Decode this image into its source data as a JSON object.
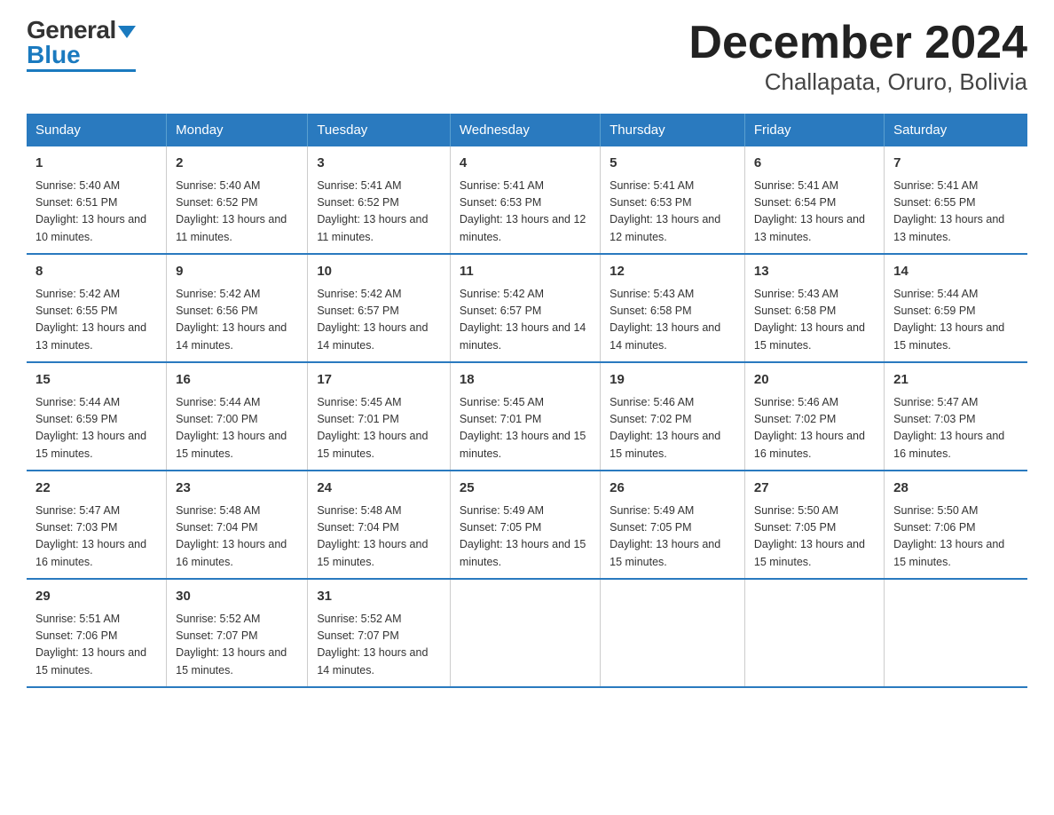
{
  "logo": {
    "general": "General",
    "blue": "Blue",
    "arrow": "▼"
  },
  "title": "December 2024",
  "subtitle": "Challapata, Oruro, Bolivia",
  "weekdays": [
    "Sunday",
    "Monday",
    "Tuesday",
    "Wednesday",
    "Thursday",
    "Friday",
    "Saturday"
  ],
  "weeks": [
    [
      {
        "day": "1",
        "sunrise": "5:40 AM",
        "sunset": "6:51 PM",
        "daylight": "13 hours and 10 minutes."
      },
      {
        "day": "2",
        "sunrise": "5:40 AM",
        "sunset": "6:52 PM",
        "daylight": "13 hours and 11 minutes."
      },
      {
        "day": "3",
        "sunrise": "5:41 AM",
        "sunset": "6:52 PM",
        "daylight": "13 hours and 11 minutes."
      },
      {
        "day": "4",
        "sunrise": "5:41 AM",
        "sunset": "6:53 PM",
        "daylight": "13 hours and 12 minutes."
      },
      {
        "day": "5",
        "sunrise": "5:41 AM",
        "sunset": "6:53 PM",
        "daylight": "13 hours and 12 minutes."
      },
      {
        "day": "6",
        "sunrise": "5:41 AM",
        "sunset": "6:54 PM",
        "daylight": "13 hours and 13 minutes."
      },
      {
        "day": "7",
        "sunrise": "5:41 AM",
        "sunset": "6:55 PM",
        "daylight": "13 hours and 13 minutes."
      }
    ],
    [
      {
        "day": "8",
        "sunrise": "5:42 AM",
        "sunset": "6:55 PM",
        "daylight": "13 hours and 13 minutes."
      },
      {
        "day": "9",
        "sunrise": "5:42 AM",
        "sunset": "6:56 PM",
        "daylight": "13 hours and 14 minutes."
      },
      {
        "day": "10",
        "sunrise": "5:42 AM",
        "sunset": "6:57 PM",
        "daylight": "13 hours and 14 minutes."
      },
      {
        "day": "11",
        "sunrise": "5:42 AM",
        "sunset": "6:57 PM",
        "daylight": "13 hours and 14 minutes."
      },
      {
        "day": "12",
        "sunrise": "5:43 AM",
        "sunset": "6:58 PM",
        "daylight": "13 hours and 14 minutes."
      },
      {
        "day": "13",
        "sunrise": "5:43 AM",
        "sunset": "6:58 PM",
        "daylight": "13 hours and 15 minutes."
      },
      {
        "day": "14",
        "sunrise": "5:44 AM",
        "sunset": "6:59 PM",
        "daylight": "13 hours and 15 minutes."
      }
    ],
    [
      {
        "day": "15",
        "sunrise": "5:44 AM",
        "sunset": "6:59 PM",
        "daylight": "13 hours and 15 minutes."
      },
      {
        "day": "16",
        "sunrise": "5:44 AM",
        "sunset": "7:00 PM",
        "daylight": "13 hours and 15 minutes."
      },
      {
        "day": "17",
        "sunrise": "5:45 AM",
        "sunset": "7:01 PM",
        "daylight": "13 hours and 15 minutes."
      },
      {
        "day": "18",
        "sunrise": "5:45 AM",
        "sunset": "7:01 PM",
        "daylight": "13 hours and 15 minutes."
      },
      {
        "day": "19",
        "sunrise": "5:46 AM",
        "sunset": "7:02 PM",
        "daylight": "13 hours and 15 minutes."
      },
      {
        "day": "20",
        "sunrise": "5:46 AM",
        "sunset": "7:02 PM",
        "daylight": "13 hours and 16 minutes."
      },
      {
        "day": "21",
        "sunrise": "5:47 AM",
        "sunset": "7:03 PM",
        "daylight": "13 hours and 16 minutes."
      }
    ],
    [
      {
        "day": "22",
        "sunrise": "5:47 AM",
        "sunset": "7:03 PM",
        "daylight": "13 hours and 16 minutes."
      },
      {
        "day": "23",
        "sunrise": "5:48 AM",
        "sunset": "7:04 PM",
        "daylight": "13 hours and 16 minutes."
      },
      {
        "day": "24",
        "sunrise": "5:48 AM",
        "sunset": "7:04 PM",
        "daylight": "13 hours and 15 minutes."
      },
      {
        "day": "25",
        "sunrise": "5:49 AM",
        "sunset": "7:05 PM",
        "daylight": "13 hours and 15 minutes."
      },
      {
        "day": "26",
        "sunrise": "5:49 AM",
        "sunset": "7:05 PM",
        "daylight": "13 hours and 15 minutes."
      },
      {
        "day": "27",
        "sunrise": "5:50 AM",
        "sunset": "7:05 PM",
        "daylight": "13 hours and 15 minutes."
      },
      {
        "day": "28",
        "sunrise": "5:50 AM",
        "sunset": "7:06 PM",
        "daylight": "13 hours and 15 minutes."
      }
    ],
    [
      {
        "day": "29",
        "sunrise": "5:51 AM",
        "sunset": "7:06 PM",
        "daylight": "13 hours and 15 minutes."
      },
      {
        "day": "30",
        "sunrise": "5:52 AM",
        "sunset": "7:07 PM",
        "daylight": "13 hours and 15 minutes."
      },
      {
        "day": "31",
        "sunrise": "5:52 AM",
        "sunset": "7:07 PM",
        "daylight": "13 hours and 14 minutes."
      },
      null,
      null,
      null,
      null
    ]
  ]
}
